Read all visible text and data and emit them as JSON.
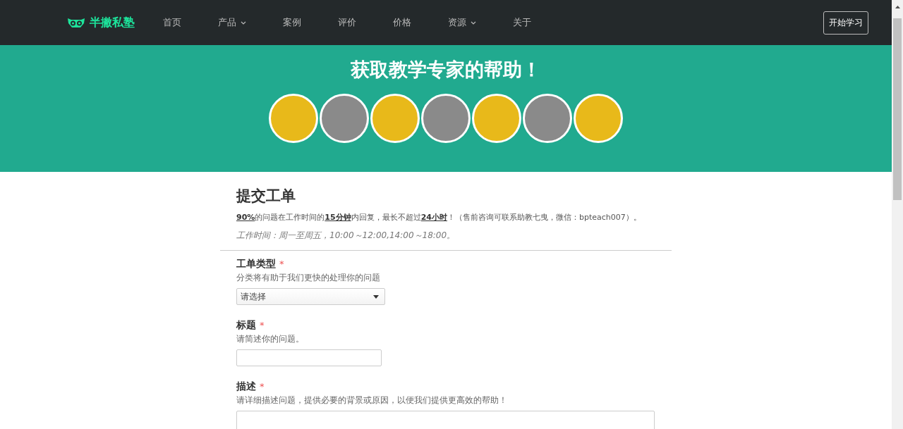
{
  "header": {
    "logo_text": "半撇私塾",
    "nav": [
      {
        "label": "首页",
        "has_dropdown": false
      },
      {
        "label": "产品",
        "has_dropdown": true
      },
      {
        "label": "案例",
        "has_dropdown": false
      },
      {
        "label": "评价",
        "has_dropdown": false
      },
      {
        "label": "价格",
        "has_dropdown": false
      },
      {
        "label": "资源",
        "has_dropdown": true
      },
      {
        "label": "关于",
        "has_dropdown": false
      }
    ],
    "cta_button": "开始学习"
  },
  "hero": {
    "title": "获取教学专家的帮助！",
    "avatars": [
      {
        "kind": "photo"
      },
      {
        "kind": "photo"
      },
      {
        "kind": "photo"
      },
      {
        "kind": "photo"
      },
      {
        "kind": "photo"
      },
      {
        "kind": "photo"
      },
      {
        "kind": "photo"
      }
    ]
  },
  "form": {
    "title": "提交工单",
    "intro": "**90%**的问题在工作时间的**15分钟**内回复，最长不超过**24小时**！（售前咨询可联系助教七曳，微信：bpteach007）。",
    "hours": "工作时间：周一至周五，10:00～12:00,14:00～18:00。",
    "fields": [
      {
        "kind": "select",
        "label": "工单类型",
        "required_mark": "*",
        "hint": "分类将有助于我们更快的处理你的问题",
        "value": "请选择"
      },
      {
        "kind": "input",
        "label": "标题",
        "required_mark": "*",
        "hint": "请简述你的问题。"
      },
      {
        "kind": "textarea",
        "label": "描述",
        "required_mark": "*",
        "hint": "请详细描述问题，提供必要的背景或原因，以便我们提供更高效的帮助！"
      }
    ]
  }
}
